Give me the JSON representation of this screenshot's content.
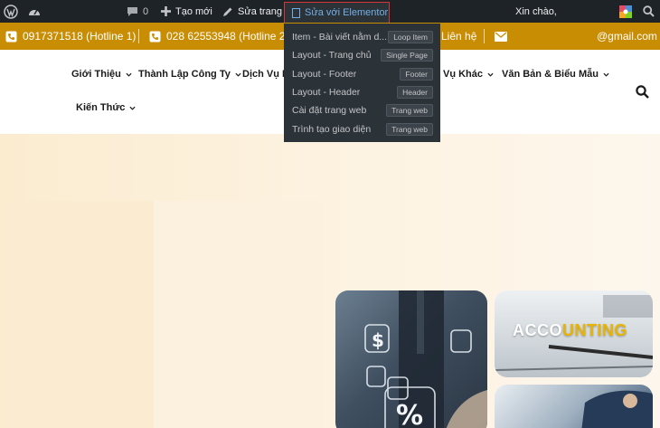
{
  "admin_bar": {
    "comments_count": "0",
    "new_label": "Tạo mới",
    "edit_page_label": "Sửa trang",
    "elementor_label": "Sửa với Elementor",
    "greeting": "Xin chào,"
  },
  "elementor_menu": [
    {
      "label": "Item - Bài viết nằm d...",
      "tag": "Loop Item"
    },
    {
      "label": "Layout - Trang chủ",
      "tag": "Single Page"
    },
    {
      "label": "Layout - Footer",
      "tag": "Footer"
    },
    {
      "label": "Layout - Header",
      "tag": "Header"
    },
    {
      "label": "Cài đặt trang web",
      "tag": "Trang web"
    },
    {
      "label": "Trình tạo giao diện",
      "tag": "Trang web"
    }
  ],
  "topbar": {
    "hotline1": "0917371518 (Hotline 1)",
    "hotline2": "028 62553948 (Hotline 2)",
    "contact": "Liên hệ",
    "email": "@gmail.com"
  },
  "nav": {
    "items": [
      "Giới Thiệu",
      "Thành Lập Công Ty",
      "Dịch Vụ K",
      "Vụ Khác",
      "Văn Bản & Biểu Mẫu",
      "Kiến Thức"
    ]
  },
  "hero": {
    "accounting_part1": "ACCO",
    "accounting_part2": "UNTING"
  },
  "colors": {
    "admin_bar": "#1d2327",
    "topbar": "#c98d04",
    "elementor_highlight": "#d63638"
  }
}
